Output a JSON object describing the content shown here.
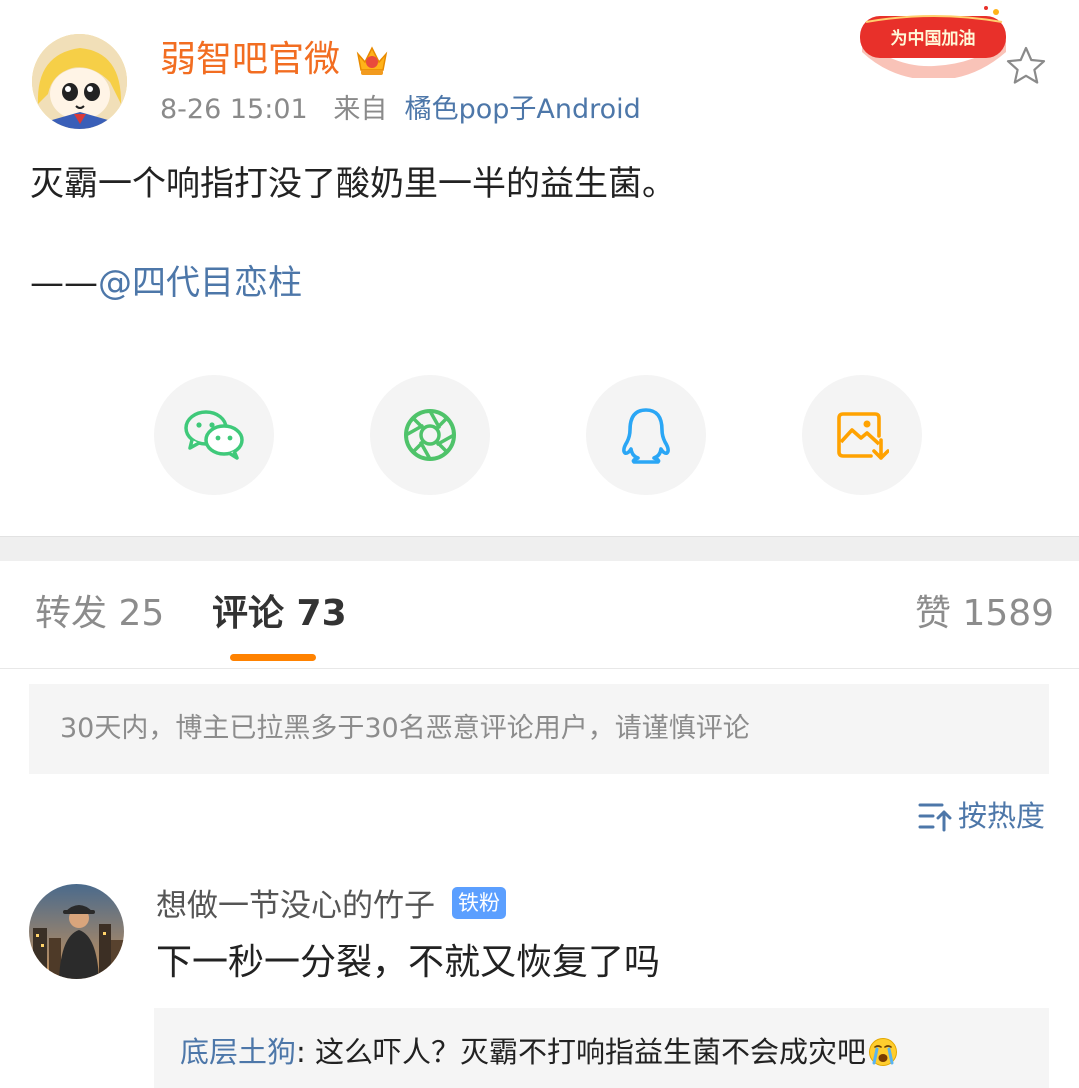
{
  "post": {
    "author": "弱智吧官微",
    "time": "8-26 15:01",
    "source_prefix": "来自",
    "source": "橘色pop子Android",
    "promo_text": "为中国加油",
    "text": "灭霸一个响指打没了酸奶里一半的益生菌。",
    "credit_prefix": "——",
    "credit_mention": "@四代目恋柱"
  },
  "share": [
    {
      "name": "wechat",
      "icon": "wechat-icon",
      "color": "#3fc97a"
    },
    {
      "name": "moments",
      "icon": "moments-icon",
      "color": "#4fc36a"
    },
    {
      "name": "qq",
      "icon": "qq-icon",
      "color": "#2aa6f5"
    },
    {
      "name": "save-image",
      "icon": "save-image-icon",
      "color": "#ffa200"
    }
  ],
  "tabs": {
    "repost": "转发 25",
    "comments": "评论 73",
    "likes": "赞 1589"
  },
  "notice": "30天内，博主已拉黑多于30名恶意评论用户，请谨慎评论",
  "sort_label": "按热度",
  "comment": {
    "user": "想做一节没心的竹子",
    "badge": "铁粉",
    "text": "下一秒一分裂，不就又恢复了吗",
    "reply_user": "底层土狗",
    "reply_sep": ": ",
    "reply_text": "这么吓人？灭霸不打响指益生菌不会成灾吧"
  },
  "colors": {
    "accent": "#ff8200",
    "name": "#f26d21",
    "link": "#4d77a9",
    "badge": "#5b9fff"
  }
}
